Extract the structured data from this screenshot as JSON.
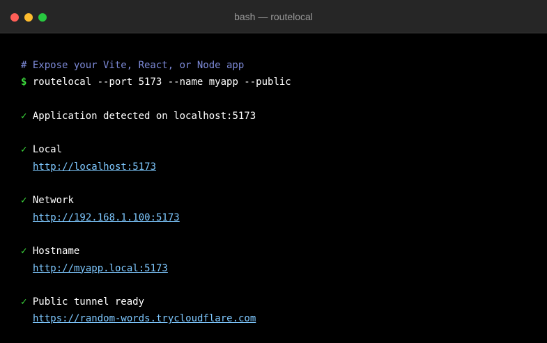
{
  "window": {
    "title": "bash — routelocal",
    "traffic_lights": {
      "close": "#ff5f57",
      "minimize": "#febc2e",
      "maximize": "#28c840"
    }
  },
  "colors": {
    "background": "#000000",
    "comment": "#7d8ad8",
    "success": "#3ddc3d",
    "link": "#7ec8ff"
  },
  "terminal": {
    "comment": "# Expose your Vite, React, or Node app",
    "prompt": "$",
    "command": "routelocal --port 5173 --name myapp --public",
    "check_glyph": "✓",
    "detected": "Application detected on localhost:5173",
    "entries": [
      {
        "label": "Local",
        "url": "http://localhost:5173"
      },
      {
        "label": "Network",
        "url": "http://192.168.1.100:5173"
      },
      {
        "label": "Hostname",
        "url": "http://myapp.local:5173"
      },
      {
        "label": "Public tunnel ready",
        "url": "https://random-words.trycloudflare.com"
      }
    ]
  }
}
